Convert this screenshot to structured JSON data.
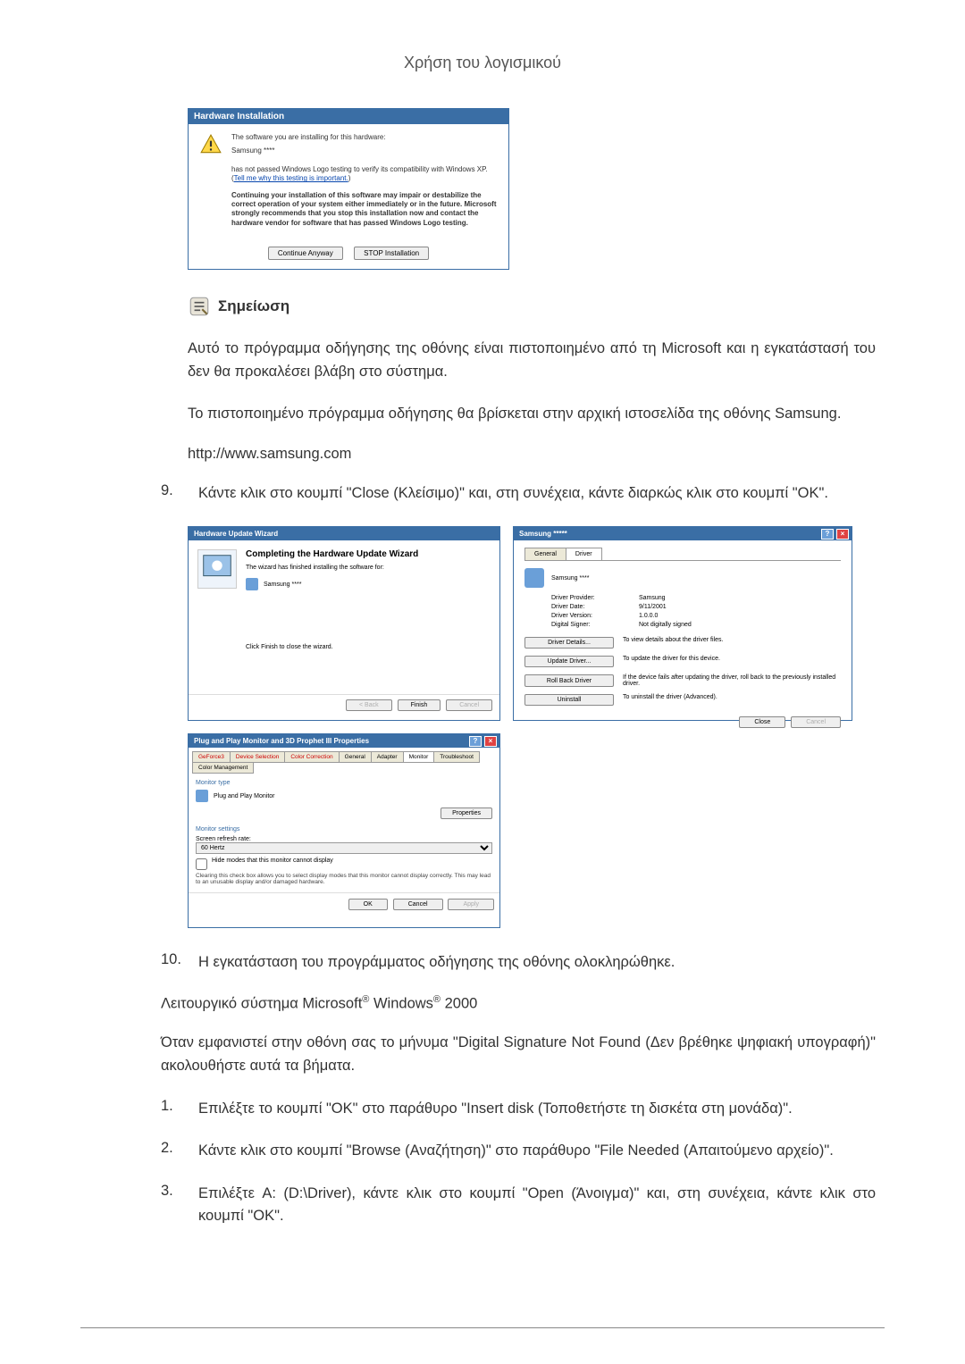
{
  "header": {
    "title": "Χρήση του λογισμικού"
  },
  "hwInstall": {
    "title": "Hardware Installation",
    "line1": "The software you are installing for this hardware:",
    "line2": "Samsung ****",
    "line3a": "has not passed Windows Logo testing to verify its compatibility with Windows XP. (",
    "line3link": "Tell me why this testing is important.",
    "line3b": ")",
    "bold": "Continuing your installation of this software may impair or destabilize the correct operation of your system either immediately or in the future. Microsoft strongly recommends that you stop this installation now and contact the hardware vendor for software that has passed Windows Logo testing.",
    "btnContinue": "Continue Anyway",
    "btnStop": "STOP Installation"
  },
  "note": {
    "label": "Σημείωση"
  },
  "para1": "Αυτό το πρόγραμμα οδήγησης της οθόνης είναι πιστοποιημένο από τη Microsoft και η εγκατάστασή του δεν θα προκαλέσει βλάβη στο σύστημα.",
  "para2": "Το πιστοποιημένο πρόγραμμα οδήγησης θα βρίσκεται στην αρχική ιστοσελίδα της οθόνης Samsung.",
  "url": "http://www.samsung.com",
  "step9": {
    "num": "9.",
    "text": "Κάντε κλικ στο κουμπί \"Close (Κλείσιμο)\" και, στη συνέχεια, κάντε διαρκώς κλικ στο κουμπί \"OK\"."
  },
  "wizard": {
    "title": "Hardware Update Wizard",
    "heading": "Completing the Hardware Update Wizard",
    "line1": "The wizard has finished installing the software for:",
    "line2": "Samsung ****",
    "lineFinish": "Click Finish to close the wizard.",
    "btnBack": "< Back",
    "btnFinish": "Finish",
    "btnCancel": "Cancel"
  },
  "driver": {
    "title": "Samsung *****",
    "tabGeneral": "General",
    "tabDriver": "Driver",
    "topLabel": "Samsung ****",
    "rows": {
      "providerLabel": "Driver Provider:",
      "providerVal": "Samsung",
      "dateLabel": "Driver Date:",
      "dateVal": "9/11/2001",
      "versionLabel": "Driver Version:",
      "versionVal": "1.0.0.0",
      "signerLabel": "Digital Signer:",
      "signerVal": "Not digitally signed"
    },
    "btns": {
      "details": "Driver Details...",
      "detailsDesc": "To view details about the driver files.",
      "update": "Update Driver...",
      "updateDesc": "To update the driver for this device.",
      "rollback": "Roll Back Driver",
      "rollbackDesc": "If the device fails after updating the driver, roll back to the previously installed driver.",
      "uninstall": "Uninstall",
      "uninstallDesc": "To uninstall the driver (Advanced)."
    },
    "btnClose": "Close",
    "btnCancel": "Cancel"
  },
  "monitor": {
    "title": "Plug and Play Monitor and 3D Prophet III Properties",
    "tabs": {
      "geforce": "GeForce3",
      "devsel": "Device Selection",
      "colorcorr": "Color Correction",
      "general": "General",
      "adapter": "Adapter",
      "monitorTab": "Monitor",
      "troubleshoot": "Troubleshoot",
      "colormgmt": "Color Management"
    },
    "sectionType": "Monitor type",
    "typeName": "Plug and Play Monitor",
    "btnProperties": "Properties",
    "sectionSettings": "Monitor settings",
    "refreshLabel": "Screen refresh rate:",
    "refreshVal": "60 Hertz",
    "hideModes": "Hide modes that this monitor cannot display",
    "hideDesc": "Clearing this check box allows you to select display modes that this monitor cannot display correctly. This may lead to an unusable display and/or damaged hardware.",
    "btnOK": "OK",
    "btnCancel": "Cancel",
    "btnApply": "Apply"
  },
  "step10": {
    "num": "10.",
    "text": "Η εγκατάσταση του προγράμματος οδήγησης της οθόνης ολοκληρώθηκε."
  },
  "osLabel": "Λειτουργικό σύστημα Microsoft",
  "osWindows": " Windows",
  "os2000": " 2000",
  "para3": "Όταν εμφανιστεί στην οθόνη σας το μήνυμα \"Digital Signature Not Found (Δεν βρέθηκε ψηφιακή υπογραφή)\" ακολουθήστε αυτά τα βήματα.",
  "step1": {
    "num": "1.",
    "text": "Επιλέξτε το κουμπί \"OK\" στο παράθυρο \"Insert disk (Τοποθετήστε τη δισκέτα στη μονάδα)\"."
  },
  "step2": {
    "num": "2.",
    "text": "Κάντε κλικ στο κουμπί \"Browse (Αναζήτηση)\" στο παράθυρο \"File Needed (Απαιτούμενο αρχείο)\"."
  },
  "step3": {
    "num": "3.",
    "text": "Επιλέξτε A: (D:\\Driver), κάντε κλικ στο κουμπί \"Open (Άνοιγμα)\" και, στη συνέχεια, κάντε κλικ στο κουμπί \"OK\"."
  }
}
